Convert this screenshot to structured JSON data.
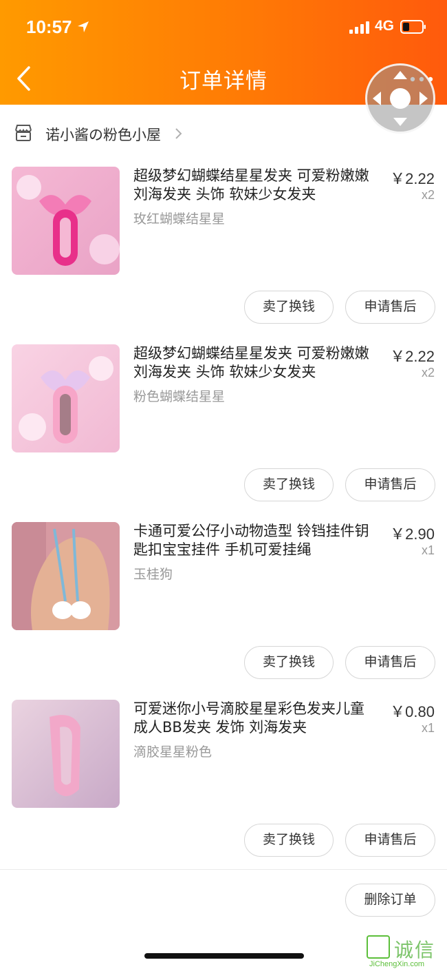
{
  "status_bar": {
    "time": "10:57",
    "network": "4G"
  },
  "header": {
    "title": "订单详情"
  },
  "shop": {
    "name": "诺小酱の粉色小屋"
  },
  "items": [
    {
      "title": "超级梦幻蝴蝶结星星发夹 可爱粉嫩嫩刘海发夹 头饰 软妹少女发夹",
      "variant": "玫红蝴蝶结星星",
      "price": "￥2.22",
      "qty": "x2",
      "sell_label": "卖了换钱",
      "after_label": "申请售后"
    },
    {
      "title": "超级梦幻蝴蝶结星星发夹 可爱粉嫩嫩刘海发夹 头饰 软妹少女发夹",
      "variant": "粉色蝴蝶结星星",
      "price": "￥2.22",
      "qty": "x2",
      "sell_label": "卖了换钱",
      "after_label": "申请售后"
    },
    {
      "title": "卡通可爱公仔小动物造型 铃铛挂件钥匙扣宝宝挂件 手机可爱挂绳",
      "variant": "玉桂狗",
      "price": "￥2.90",
      "qty": "x1",
      "sell_label": "卖了换钱",
      "after_label": "申请售后"
    },
    {
      "title": "可爱迷你小号滴胶星星彩色发夹儿童成人BB发夹 发饰 刘海发夹",
      "variant": "滴胶星星粉色",
      "price": "￥0.80",
      "qty": "x1",
      "sell_label": "卖了换钱",
      "after_label": "申请售后"
    }
  ],
  "footer": {
    "delete_label": "删除订单"
  },
  "watermark": {
    "text": "诚信",
    "url": "JiChengXin.com"
  },
  "colors": {
    "header_start": "#ff9a00",
    "header_end": "#ff5a0c",
    "muted_text": "#999999",
    "button_border": "#d6d6d6"
  }
}
